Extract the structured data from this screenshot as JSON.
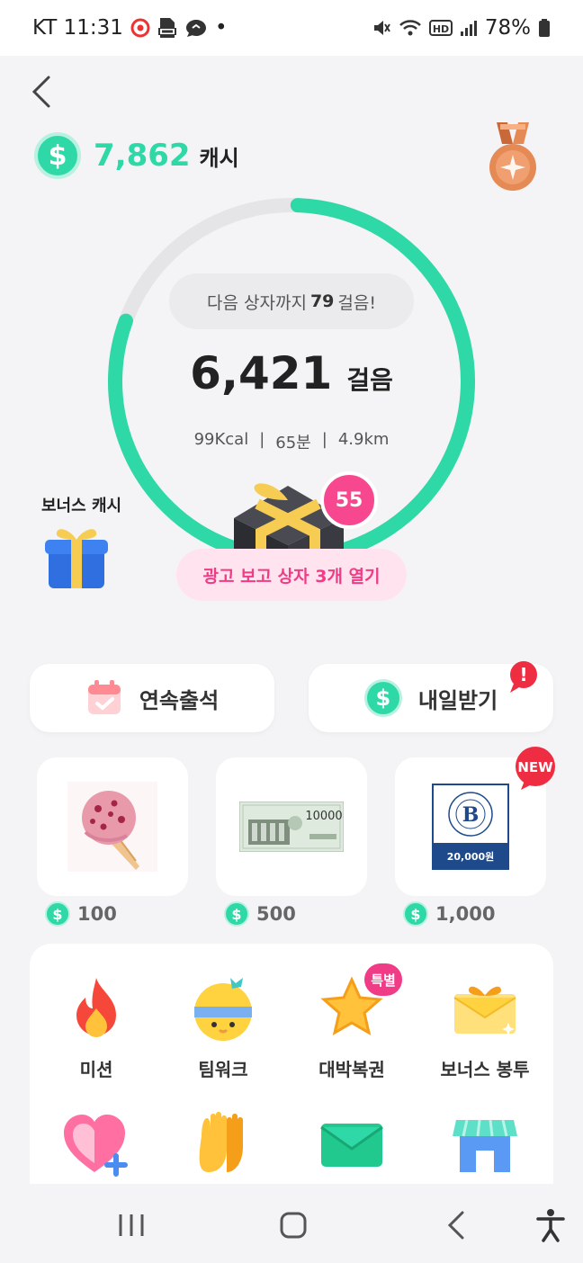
{
  "status_bar": {
    "carrier_time": "KT 11:31",
    "dot": "•",
    "battery": "78%",
    "icons": [
      "target-app-icon",
      "pdf-icon",
      "chat-bubble-icon",
      "mute-icon",
      "wifi-icon",
      "hd-icon",
      "signal-icon",
      "battery-icon"
    ]
  },
  "header": {
    "back_icon": "chevron-left-icon",
    "cash_symbol": "$",
    "cash_amount": "7,862",
    "cash_unit": "캐시",
    "medal_icon": "bronze-medal-icon"
  },
  "progress": {
    "next_prefix": "다음 상자까지",
    "next_steps": "79",
    "next_suffix": "걸음!",
    "steps": "6,421",
    "steps_unit": "걸음",
    "kcal": "99Kcal",
    "sep1": "|",
    "minutes": "65분",
    "sep2": "|",
    "distance": "4.9km",
    "ring_fraction": 0.8,
    "ring_color": "#2ed8a7"
  },
  "bonus": {
    "label": "보너스 캐시",
    "gift_icon": "blue-gift-icon"
  },
  "box": {
    "badge": "55",
    "ad_button": "광고 보고 상자 3개 열기",
    "box_icon": "black-treasure-box-icon"
  },
  "actions": {
    "attendance": "연속출석",
    "tomorrow": "내일받기",
    "alert": "!"
  },
  "rewards": [
    {
      "icon": "ice-cream-cone-icon",
      "price": "100"
    },
    {
      "icon": "gift-voucher-10000-icon",
      "voucher_text": "10000",
      "price": "500"
    },
    {
      "icon": "paris-baguette-voucher-icon",
      "voucher_text": "20,000원",
      "price": "1,000"
    }
  ],
  "new_badge": "NEW",
  "menu": [
    {
      "label": "미션",
      "icon": "fire-icon"
    },
    {
      "label": "팀워크",
      "icon": "smiley-headband-icon"
    },
    {
      "label": "대박복권",
      "icon": "star-icon",
      "badge": "특별"
    },
    {
      "label": "보너스 봉투",
      "icon": "envelope-gold-icon"
    },
    {
      "label": "",
      "icon": "heart-plus-icon"
    },
    {
      "label": "",
      "icon": "clapping-hands-icon"
    },
    {
      "label": "",
      "icon": "mail-green-icon"
    },
    {
      "label": "",
      "icon": "store-icon"
    }
  ],
  "nav": {
    "recent": "recent-apps-icon",
    "home": "home-icon",
    "back": "back-icon",
    "accessibility": "accessibility-icon"
  },
  "colors": {
    "accent_green": "#2ed8a7",
    "accent_pink": "#f03b86",
    "bronze": "#e58a55"
  }
}
